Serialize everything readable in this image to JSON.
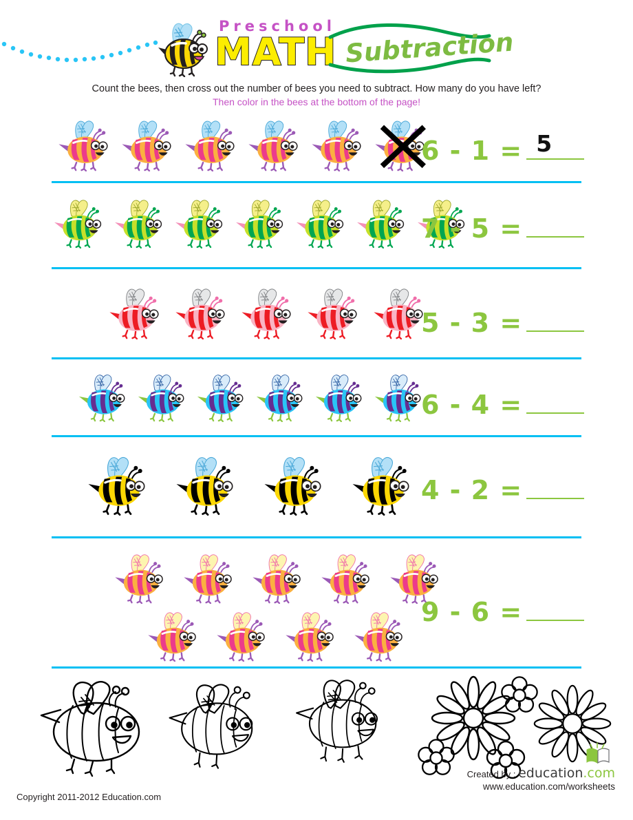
{
  "header": {
    "title_preschool": "Preschool",
    "title_math": "MATH",
    "title_subtraction": "Subtraction",
    "bee_icon": "bee-logo-icon",
    "dot_trail_icon": "dotted-flight-path-icon",
    "colors": {
      "preschool_purple": "#c552c5",
      "math_yellow": "#fced00",
      "subtraction_green": "#7dbb42",
      "swoosh_green": "#00a14b",
      "dot_cyan": "#29c5f6"
    }
  },
  "instructions": {
    "line1": "Count the bees, then cross out the number of bees you need to subtract. How many do you have left?",
    "line2": "Then color in the bees at the bottom of the page!"
  },
  "worksheet": {
    "divider_color": "#00bff3",
    "equation_color": "#8cc63f",
    "answer_color": "#111111",
    "problems": [
      {
        "id": "problem-1",
        "minuend": 6,
        "subtrahend": 1,
        "equation": "6 - 1 =",
        "answer": "5",
        "bee_count": 6,
        "crossed_out": 1,
        "bee_color_name": "pink-orange-bee",
        "layout": "single-row",
        "bee_style": {
          "stripe_a": "#f48fb8",
          "stripe_b": "#f9a03f",
          "body_main": "#fbb040",
          "stripe_dark": "#ec3b8b",
          "wing": "#b3e0f7",
          "wing_line": "#4aa8d8",
          "leg": "#9b59b6",
          "antenna": "#9b59b6",
          "stinger": "#9b59b6"
        }
      },
      {
        "id": "problem-2",
        "minuend": 7,
        "subtrahend": 5,
        "equation": "7 - 5 =",
        "answer": "",
        "bee_count": 7,
        "crossed_out": 0,
        "bee_color_name": "green-bee",
        "layout": "single-row",
        "bee_style": {
          "stripe_a": "#c6e02a",
          "stripe_b": "#00a651",
          "body_main": "#c6e02a",
          "stripe_dark": "#00a651",
          "wing": "#f5ef8a",
          "wing_line": "#9aa52a",
          "leg": "#00a651",
          "antenna": "#00a651",
          "stinger": "#f48fb8"
        }
      },
      {
        "id": "problem-3",
        "minuend": 5,
        "subtrahend": 3,
        "equation": "5 - 3 =",
        "answer": "",
        "bee_count": 5,
        "crossed_out": 0,
        "bee_color_name": "red-pink-bee",
        "layout": "single-row-indented",
        "bee_style": {
          "stripe_a": "#f9b4c4",
          "stripe_b": "#ed1c24",
          "body_main": "#f9b4c4",
          "stripe_dark": "#ed1c24",
          "wing": "#e6e7e8",
          "wing_line": "#808285",
          "leg": "#ed1c24",
          "antenna": "#f06eaa",
          "stinger": "#ed1c24"
        }
      },
      {
        "id": "problem-4",
        "minuend": 6,
        "subtrahend": 4,
        "equation": "6 - 4 =",
        "answer": "",
        "bee_count": 6,
        "crossed_out": 0,
        "bee_color_name": "blue-purple-bee",
        "layout": "single-row",
        "bee_style": {
          "stripe_a": "#29c5f6",
          "stripe_b": "#6m",
          "body_main": "#29c5f6",
          "stripe_dark": "#662d91",
          "wing": "#d9ecfa",
          "wing_line": "#2e5fa3",
          "leg": "#8cc63f",
          "antenna": "#662d91",
          "stinger": "#8cc63f"
        }
      },
      {
        "id": "problem-5",
        "minuend": 4,
        "subtrahend": 2,
        "equation": "4 - 2 =",
        "answer": "",
        "bee_count": 4,
        "crossed_out": 0,
        "bee_color_name": "classic-yellow-black-bee",
        "layout": "spaced-row",
        "bee_style": {
          "stripe_a": "#fcd703",
          "stripe_b": "#000000",
          "body_main": "#fcd703",
          "stripe_dark": "#000000",
          "wing": "#b3e0f7",
          "wing_line": "#4aa8d8",
          "leg": "#000000",
          "antenna": "#000000",
          "stinger": "#000000"
        }
      },
      {
        "id": "problem-6",
        "minuend": 9,
        "subtrahend": 6,
        "equation": "9 - 6 =",
        "answer": "",
        "bee_count": 9,
        "crossed_out": 0,
        "bee_color_name": "magenta-orange-bee",
        "layout": "two-rows-5-4",
        "bee_style": {
          "stripe_a": "#fbb040",
          "stripe_b": "#ec3b8b",
          "body_main": "#fbb040",
          "stripe_dark": "#ec3b8b",
          "wing": "#fdf5b0",
          "wing_line": "#f06eaa",
          "leg": "#9b59b6",
          "antenna": "#9b59b6",
          "stinger": "#9b59b6"
        }
      }
    ]
  },
  "coloring_section": {
    "label": "outline-bees-and-flowers-to-color",
    "bee_outlines": 3,
    "large_flowers": 2,
    "small_flowers": 3,
    "outline_color": "#000000"
  },
  "footer": {
    "copyright": "Copyright 2011-2012 Education.com",
    "created_by": "Created by :",
    "brand_name": "education",
    "brand_suffix": ".com",
    "url": "www.education.com/worksheets",
    "book_icon": "open-book-logo-icon"
  }
}
